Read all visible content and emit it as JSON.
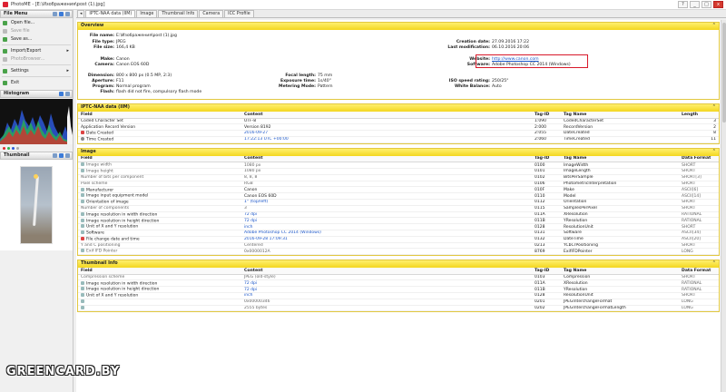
{
  "window": {
    "title": "PhotoME - [E:\\Изображения\\post (1).jpg]",
    "buttons": [
      "?",
      "_",
      "□",
      "x"
    ]
  },
  "tabs": [
    "IPTC-NAA data (IIM)",
    "Image",
    "Thumbnail Info",
    "Camera",
    "ICC Profile"
  ],
  "file_menu": {
    "title": "File Menu",
    "items": [
      {
        "label": "Open file...",
        "disabled": false,
        "submenu": false
      },
      {
        "label": "Save file",
        "disabled": true,
        "submenu": false
      },
      {
        "label": "Save as...",
        "disabled": false,
        "submenu": false
      },
      {
        "label": "Import/Export",
        "disabled": false,
        "submenu": true
      },
      {
        "label": "PhotoBrowser...",
        "disabled": true,
        "submenu": false
      },
      {
        "label": "Settings",
        "disabled": false,
        "submenu": true
      },
      {
        "label": "Exit",
        "disabled": false,
        "submenu": false
      }
    ]
  },
  "histogram": {
    "title": "Histogram"
  },
  "thumbnail": {
    "title": "Thumbnail"
  },
  "overview": {
    "title": "Overview",
    "fields": {
      "file_name": {
        "label": "File name:",
        "value": "E:\\Изображения\\post (1).jpg"
      },
      "file_type": {
        "label": "File type:",
        "value": "JPEG"
      },
      "file_size": {
        "label": "File size:",
        "value": "166,4 KB"
      },
      "creation_date": {
        "label": "Creation date:",
        "value": "27.09.2016 17:22"
      },
      "last_mod": {
        "label": "Last modification:",
        "value": "06.10.2016 20:06"
      },
      "make": {
        "label": "Make:",
        "value": "Canon"
      },
      "camera": {
        "label": "Camera:",
        "value": "Canon EOS 60D"
      },
      "website": {
        "label": "Website:",
        "value": "http://www.canon.com"
      },
      "software": {
        "label": "Software:",
        "value": "Adobe Photoshop CC 2014 (Windows)"
      },
      "dimension": {
        "label": "Dimension:",
        "value": "800 x 800 px (0.5 MP, 2:3)"
      },
      "aperture": {
        "label": "Aperture:",
        "value": "F11"
      },
      "program": {
        "label": "Program:",
        "value": "Normal program"
      },
      "flash": {
        "label": "Flash:",
        "value": "flash did not fire, compulsory flash mode"
      },
      "focal": {
        "label": "Focal length:",
        "value": "75 mm"
      },
      "exposure": {
        "label": "Exposure time:",
        "value": "1s/40\""
      },
      "metering": {
        "label": "Metering Mode:",
        "value": "Pattern"
      },
      "iso": {
        "label": "ISO speed rating:",
        "value": "250/25°"
      },
      "wb": {
        "label": "White Balance:",
        "value": "Auto"
      }
    }
  },
  "iptc": {
    "title": "IPTC-NAA data (IIM)",
    "columns": [
      "Field",
      "Content",
      "Tag-ID",
      "Tag Name",
      "Length"
    ],
    "rows": [
      {
        "icon": "",
        "field": "Coded Character Set",
        "content": "UTF-8",
        "tag": "1:090",
        "name": "CodedCharacterSet",
        "len": "3",
        "link": false
      },
      {
        "icon": "",
        "field": "Application Record Version",
        "content": "Version 8192",
        "tag": "2:000",
        "name": "RecordVersion",
        "len": "2",
        "link": false
      },
      {
        "icon": "cal",
        "field": "Date Created",
        "content": "2016-09-27",
        "tag": "2:055",
        "name": "DateCreated",
        "len": "8",
        "link": true
      },
      {
        "icon": "clk",
        "field": "Time Created",
        "content": "17:22:13 UTC +00:00",
        "tag": "2:060",
        "name": "TimeCreated",
        "len": "11",
        "link": true
      }
    ]
  },
  "image": {
    "title": "Image",
    "columns": [
      "Field",
      "Content",
      "Tag-ID",
      "Tag Name",
      "Data Format"
    ],
    "rows": [
      {
        "icon": "ri",
        "field": "Image width",
        "content": "1080 px",
        "tag": "0100",
        "name": "ImageWidth",
        "fmt": "SHORT",
        "dark": false,
        "link": false
      },
      {
        "icon": "ri",
        "field": "Image height",
        "content": "1080 px",
        "tag": "0101",
        "name": "ImageLength",
        "fmt": "SHORT",
        "dark": false,
        "link": false
      },
      {
        "icon": "",
        "field": "Number of bits per component",
        "content": "8, 8, 8",
        "tag": "0102",
        "name": "BitsPerSample",
        "fmt": "SHORT[3]",
        "dark": false,
        "link": false
      },
      {
        "icon": "",
        "field": "Pixel scheme",
        "content": "RGB",
        "tag": "0106",
        "name": "PhotometricInterpretation",
        "fmt": "SHORT",
        "dark": false,
        "link": false
      },
      {
        "icon": "ri",
        "field": "Manufacturer",
        "content": "Canon",
        "tag": "010F",
        "name": "Make",
        "fmt": "ASCII[6]",
        "dark": true,
        "link": false
      },
      {
        "icon": "ri",
        "field": "Image input equipment model",
        "content": "Canon EOS 60D",
        "tag": "0110",
        "name": "Model",
        "fmt": "ASCII[14]",
        "dark": true,
        "link": false
      },
      {
        "icon": "ri",
        "field": "Orientation of image",
        "content": "1° (top/left)",
        "tag": "0112",
        "name": "Orientation",
        "fmt": "SHORT",
        "dark": true,
        "link": true
      },
      {
        "icon": "",
        "field": "Number of components",
        "content": "3",
        "tag": "0115",
        "name": "SamplesPerPixel",
        "fmt": "SHORT",
        "dark": false,
        "link": false
      },
      {
        "icon": "ri",
        "field": "Image resolution in width direction",
        "content": "72 dpi",
        "tag": "011A",
        "name": "XResolution",
        "fmt": "RATIONAL",
        "dark": true,
        "link": true
      },
      {
        "icon": "ri",
        "field": "Image resolution in height direction",
        "content": "72 dpi",
        "tag": "011B",
        "name": "YResolution",
        "fmt": "RATIONAL",
        "dark": true,
        "link": true
      },
      {
        "icon": "ri",
        "field": "Unit of X and Y resolution",
        "content": "inch",
        "tag": "0128",
        "name": "ResolutionUnit",
        "fmt": "SHORT",
        "dark": true,
        "link": true
      },
      {
        "icon": "ri",
        "field": "Software",
        "content": "Adobe Photoshop CC 2014 (Windows)",
        "tag": "0131",
        "name": "Software",
        "fmt": "ASCII[34]",
        "dark": true,
        "link": true
      },
      {
        "icon": "cal",
        "field": "File change date and time",
        "content": "2016-09-28 17:09:31",
        "tag": "0132",
        "name": "DateTime",
        "fmt": "ASCII[20]",
        "dark": true,
        "link": true
      },
      {
        "icon": "",
        "field": "Y and C positioning",
        "content": "Centered",
        "tag": "0213",
        "name": "YCbCrPositioning",
        "fmt": "SHORT",
        "dark": false,
        "link": false
      },
      {
        "icon": "ri",
        "field": "Exif IFD Pointer",
        "content": "0x0000012A",
        "tag": "8769",
        "name": "ExifIFDPointer",
        "fmt": "LONG",
        "dark": false,
        "link": false
      }
    ]
  },
  "thumbinfo": {
    "title": "Thumbnail Info",
    "columns": [
      "Field",
      "Content",
      "Tag-ID",
      "Tag Name",
      "Data Format"
    ],
    "rows": [
      {
        "icon": "",
        "field": "Compression scheme",
        "content": "JPEG (old-style)",
        "tag": "0103",
        "name": "Compression",
        "fmt": "SHORT",
        "dark": false,
        "link": false
      },
      {
        "icon": "ri",
        "field": "Image resolution in width direction",
        "content": "72 dpi",
        "tag": "011A",
        "name": "XResolution",
        "fmt": "RATIONAL",
        "dark": true,
        "link": true
      },
      {
        "icon": "ri",
        "field": "Image resolution in height direction",
        "content": "72 dpi",
        "tag": "011B",
        "name": "YResolution",
        "fmt": "RATIONAL",
        "dark": true,
        "link": true
      },
      {
        "icon": "ri",
        "field": "Unit of X and Y resolution",
        "content": "inch",
        "tag": "0128",
        "name": "ResolutionUnit",
        "fmt": "SHORT",
        "dark": true,
        "link": true
      },
      {
        "icon": "ri",
        "field": "",
        "content": "0x00000346",
        "tag": "0201",
        "name": "JPEGInterchangeFormat",
        "fmt": "LONG",
        "dark": false,
        "link": false
      },
      {
        "icon": "ri",
        "field": "",
        "content": "2555 bytes",
        "tag": "0202",
        "name": "JPEGInterchangeFormatLength",
        "fmt": "LONG",
        "dark": false,
        "link": false
      }
    ]
  },
  "watermark": "GREENCARD.BY"
}
